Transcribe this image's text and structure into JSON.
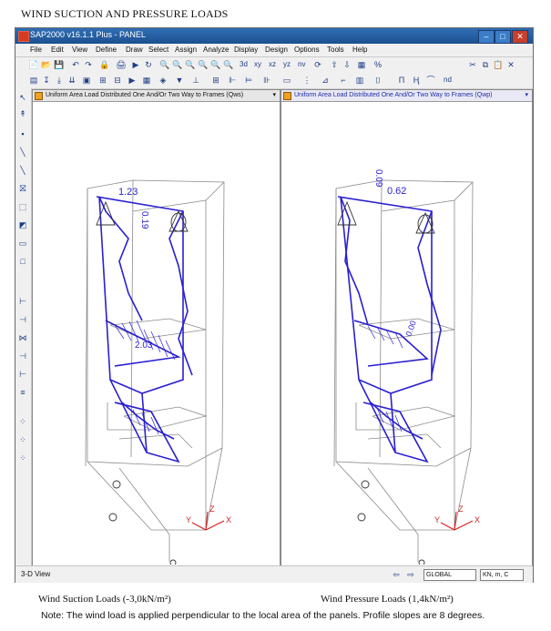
{
  "doc": {
    "title": "WIND SUCTION AND PRESSURE LOADS",
    "caption_left": "Wind Suction Loads (-3,0kN/m²)",
    "caption_right": "Wind Pressure Loads (1,4kN/m²)",
    "note": "Note: The wind load is applied perpendicular to the local area of the panels. Profile slopes are 8 degrees."
  },
  "window": {
    "title": "SAP2000 v16.1.1 Plus - PANEL",
    "minimize": "–",
    "maximize": "□",
    "close": "✕"
  },
  "menu": [
    "File",
    "Edit",
    "View",
    "Define",
    "Draw",
    "Select",
    "Assign",
    "Analyze",
    "Display",
    "Design",
    "Options",
    "Tools",
    "Help"
  ],
  "toolbar": {
    "icons": [
      "📄",
      "📂",
      "💾",
      "↶",
      "↷",
      "🔒",
      "🖨",
      "▶",
      "↻",
      "🔍",
      "🔍",
      "🔍",
      "🔍",
      "🔍",
      "🔍"
    ],
    "view_labels": [
      "3d",
      "xy",
      "xz",
      "yz",
      "nv"
    ],
    "right_icons": [
      "✂",
      "⧉",
      "📋",
      "✕"
    ]
  },
  "toolbar2": {
    "nd_label": "nd"
  },
  "left_tools": [
    "↖",
    "↟",
    "▪",
    "╲",
    "╲",
    "⛝",
    "⬚",
    "◩",
    "▭",
    "□",
    "⊢",
    "⊣",
    "⋈",
    "⊣",
    "⊢",
    "≡",
    "⁘",
    "⁘",
    "⁘"
  ],
  "pane_left": {
    "header": "Uniform Area Load Distributed One And/Or Two Way to Frames (Qws)",
    "labels": [
      "1.23",
      "0.19",
      "2.03"
    ]
  },
  "pane_right": {
    "header": "Uniform Area Load Distributed One And/Or Two Way to Frames (Qwp)",
    "labels": [
      "0.09",
      "0.62",
      "0.00"
    ]
  },
  "status": {
    "view": "3-D View",
    "coord_system": "GLOBAL",
    "units": "KN, m, C"
  },
  "colors": {
    "frame": "#2a1fd1",
    "grid": "#8a8a8a",
    "axis_red": "#d82020",
    "title_blue": "#2f6fb6"
  }
}
